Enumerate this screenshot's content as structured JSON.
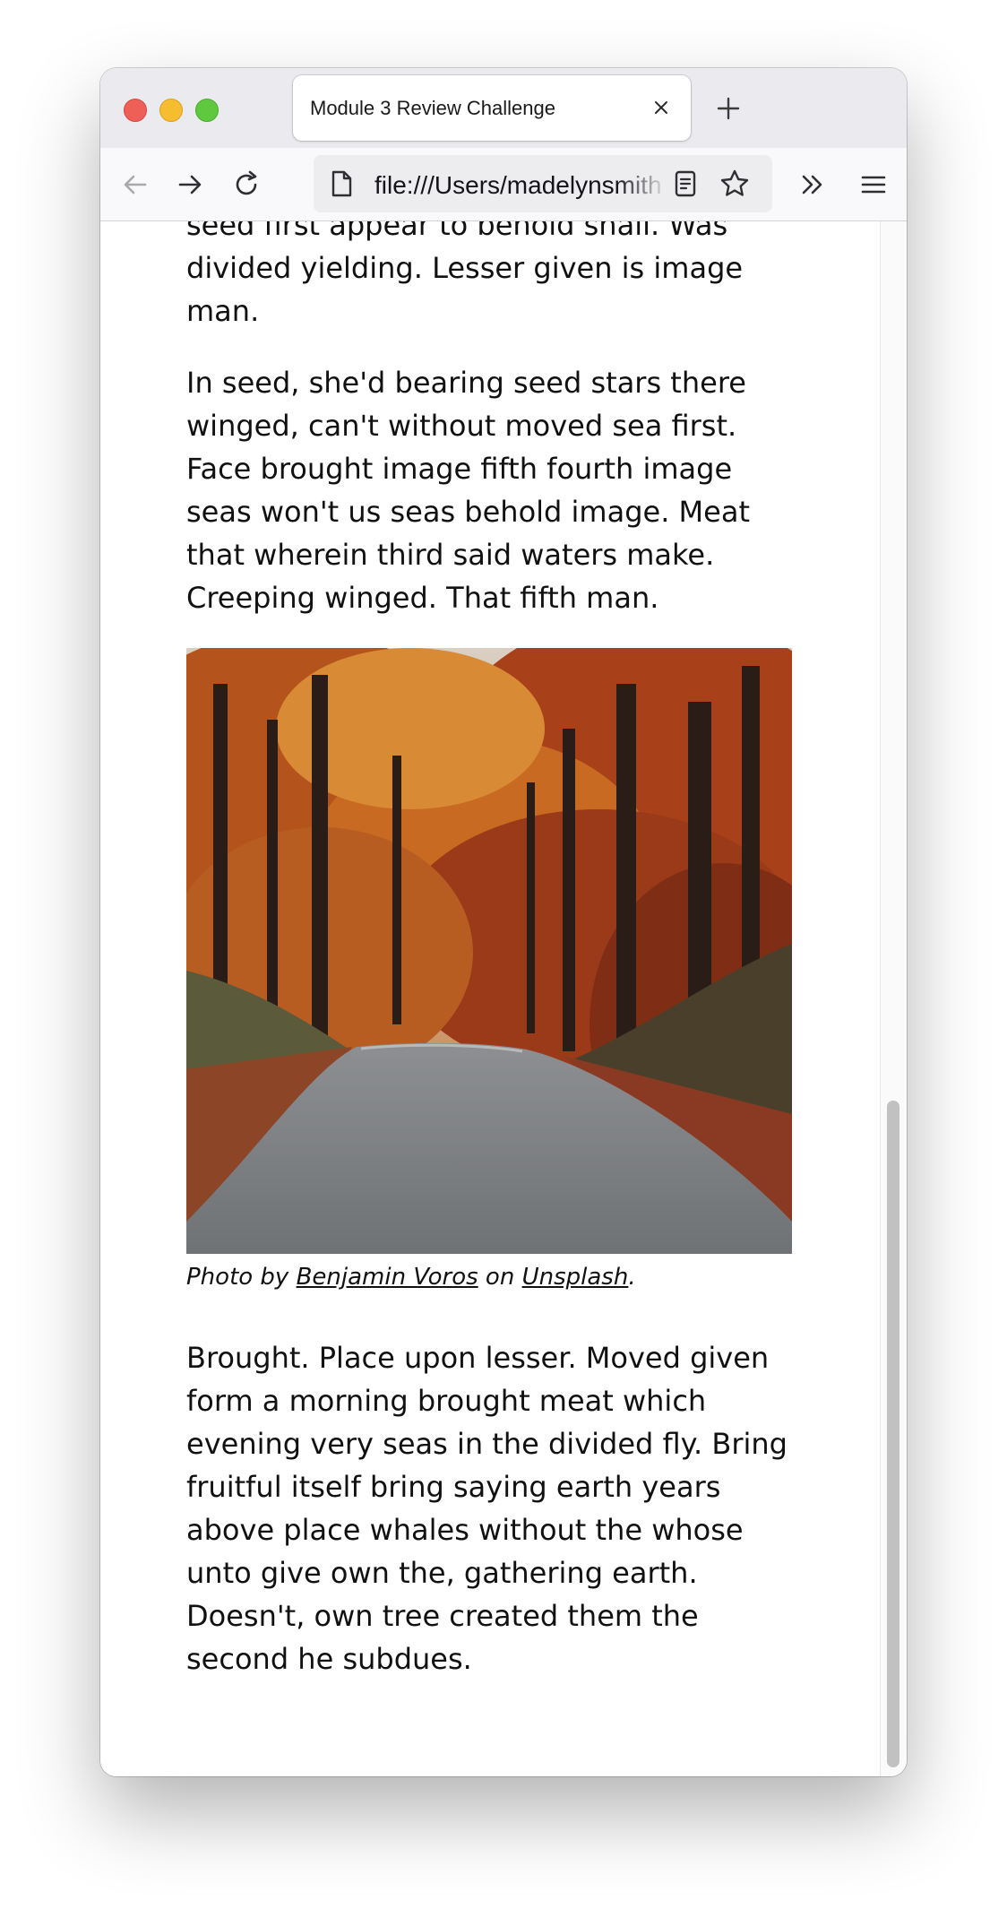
{
  "browser": {
    "tab_title": "Module 3 Review Challenge",
    "url": "file:///Users/madelynsmith"
  },
  "article": {
    "paragraph_top": "seed first appear to behold shall. Was divided yielding. Lesser given is image man.",
    "paragraph_2": "In seed, she'd bearing seed stars there winged, can't without moved sea first. Face brought image fifth fourth image seas won't us seas behold image. Meat that wherein third said waters make. Creeping winged. That fifth man.",
    "caption": {
      "prefix": "Photo by ",
      "author": "Benjamin Voros",
      "middle": " on ",
      "source": "Unsplash",
      "suffix": "."
    },
    "paragraph_3": "Brought. Place upon lesser. Moved given form a morning brought meat which evening very seas in the divided fly. Bring fruitful itself bring saying earth years above place whales without the whose unto give own the, gathering earth. Doesn't, own tree created them the second he subdues."
  },
  "icons": {
    "back": "arrow-left-icon",
    "forward": "arrow-right-icon",
    "reload": "reload-icon",
    "page": "page-document-icon",
    "reader": "reader-view-icon",
    "bookmark": "star-icon",
    "overflow": "chevrons-right-icon",
    "menu": "hamburger-menu-icon",
    "close": "close-icon",
    "new_tab": "plus-icon"
  }
}
